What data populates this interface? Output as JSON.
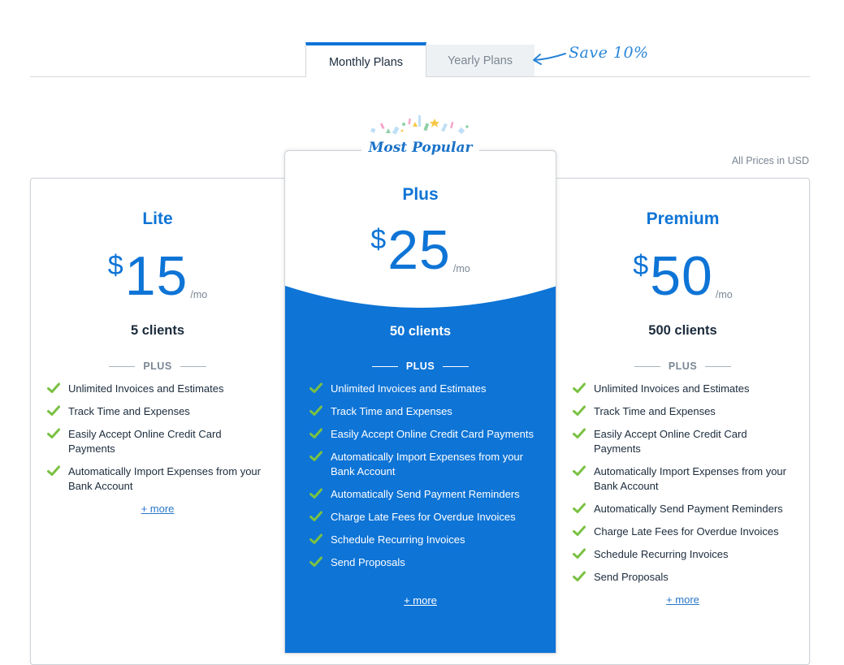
{
  "tabs": {
    "monthly": "Monthly Plans",
    "yearly": "Yearly Plans",
    "save_note": "Save 10%"
  },
  "currency_note": "All Prices in USD",
  "badge": "Most Popular",
  "plans": [
    {
      "name": "Lite",
      "currency": "$",
      "amount": "15",
      "period": "/mo",
      "clients": "5 clients",
      "plus_label": "PLUS",
      "features": [
        "Unlimited Invoices and Estimates",
        "Track Time and Expenses",
        "Easily Accept Online Credit Card Payments",
        "Automatically Import Expenses from your Bank Account"
      ],
      "more": "+ more"
    },
    {
      "name": "Plus",
      "currency": "$",
      "amount": "25",
      "period": "/mo",
      "clients": "50 clients",
      "plus_label": "PLUS",
      "features": [
        "Unlimited Invoices and Estimates",
        "Track Time and Expenses",
        "Easily Accept Online Credit Card Payments",
        "Automatically Import Expenses from your Bank Account",
        "Automatically Send Payment Reminders",
        "Charge Late Fees for Overdue Invoices",
        "Schedule Recurring Invoices",
        "Send Proposals"
      ],
      "more": "+ more"
    },
    {
      "name": "Premium",
      "currency": "$",
      "amount": "50",
      "period": "/mo",
      "clients": "500 clients",
      "plus_label": "PLUS",
      "features": [
        "Unlimited Invoices and Estimates",
        "Track Time and Expenses",
        "Easily Accept Online Credit Card Payments",
        "Automatically Import Expenses from your Bank Account",
        "Automatically Send Payment Reminders",
        "Charge Late Fees for Overdue Invoices",
        "Schedule Recurring Invoices",
        "Send Proposals"
      ],
      "more": "+ more"
    }
  ],
  "colors": {
    "accent": "#0e74d6",
    "check": "#7ac142",
    "muted": "#7b8794"
  }
}
